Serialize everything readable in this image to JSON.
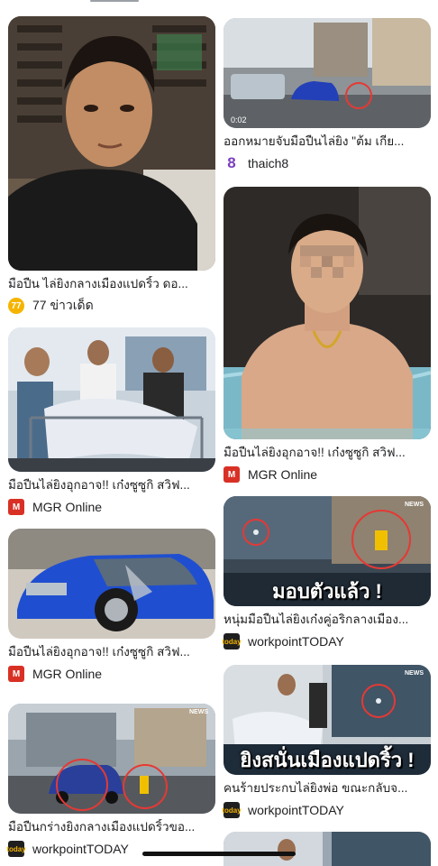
{
  "results": {
    "left": [
      {
        "caption": "มือปืน ไล่ยิงกลางเมืองแปดริ้ว ดอ...",
        "source": "77 ข่าวเด็ด",
        "logo": "77"
      },
      {
        "caption": "มือปืนไล่ยิงอุกอาจ!! เก๋งซูซูกิ สวิฟ...",
        "source": "MGR Online",
        "logo": "M"
      },
      {
        "caption": "มือปืนไล่ยิงอุกอาจ!! เก๋งซูซูกิ สวิฟ...",
        "source": "MGR Online",
        "logo": "M"
      },
      {
        "caption": "มือปืนกร่างยิงกลางเมืองแปดริ้วขอ...",
        "source": "workpointTODAY",
        "logo": "today"
      }
    ],
    "right": [
      {
        "caption": "ออกหมายจับมือปืนไล่ยิง \"ต้ม เกีย...",
        "source": "thaich8",
        "logo": "8",
        "time_label": "0:02"
      },
      {
        "caption": "มือปืนไล่ยิงอุกอาจ!! เก๋งซูซูกิ สวิฟ...",
        "source": "MGR Online",
        "logo": "M"
      },
      {
        "caption": "หนุ่มมือปืนไล่ยิงเก๋งคู่อริกลางเมือง...",
        "source": "workpointTODAY",
        "logo": "today",
        "overlay": "มอบตัวแล้ว !",
        "news_tag": "NEWS"
      },
      {
        "caption": "คนร้ายประกบไล่ยิงพ่อ ขณะกลับจ...",
        "source": "workpointTODAY",
        "logo": "today",
        "overlay": "ยิงสนั่นเมืองแปดริ้ว !",
        "news_tag": "NEWS"
      }
    ]
  },
  "colors": {
    "mgr_red": "#d93025",
    "circle_red": "#e53935",
    "car_blue": "#1f4fd0"
  }
}
